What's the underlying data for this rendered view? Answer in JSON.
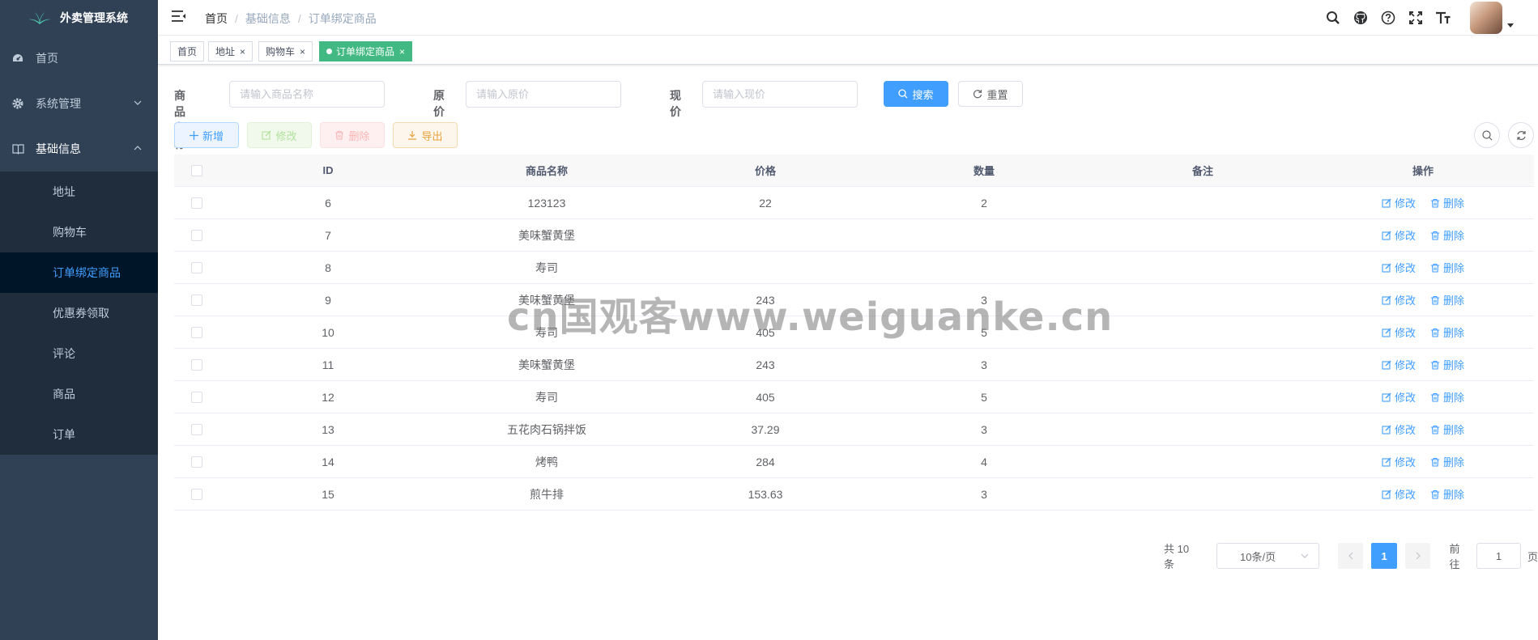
{
  "app": {
    "title": "外卖管理系统"
  },
  "sidebar": {
    "items": [
      {
        "label": "首页",
        "icon": "dashboard-icon"
      },
      {
        "label": "系统管理",
        "icon": "gear-icon"
      },
      {
        "label": "基础信息",
        "icon": "book-icon"
      }
    ],
    "submenu": [
      "地址",
      "购物车",
      "订单绑定商品",
      "优惠券领取",
      "评论",
      "商品",
      "订单"
    ],
    "active": "订单绑定商品"
  },
  "breadcrumb": [
    "首页",
    "基础信息",
    "订单绑定商品"
  ],
  "tags": [
    {
      "label": "首页"
    },
    {
      "label": "地址"
    },
    {
      "label": "购物车"
    },
    {
      "label": "订单绑定商品"
    }
  ],
  "search": {
    "name_label": "商品名称",
    "name_placeholder": "请输入商品名称",
    "orig_label": "原价",
    "orig_placeholder": "请输入原价",
    "now_label": "现价",
    "now_placeholder": "请输入现价",
    "search_btn": "搜索",
    "reset_btn": "重置"
  },
  "toolbar": {
    "add": "新增",
    "edit": "修改",
    "delete": "删除",
    "export": "导出"
  },
  "table": {
    "headers": [
      "ID",
      "商品名称",
      "价格",
      "数量",
      "备注",
      "操作"
    ],
    "rows": [
      [
        "6",
        "123123",
        "22",
        "2",
        ""
      ],
      [
        "7",
        "美味蟹黄堡",
        "",
        "",
        ""
      ],
      [
        "8",
        "寿司",
        "",
        "",
        ""
      ],
      [
        "9",
        "美味蟹黄堡",
        "243",
        "3",
        ""
      ],
      [
        "10",
        "寿司",
        "405",
        "5",
        ""
      ],
      [
        "11",
        "美味蟹黄堡",
        "243",
        "3",
        ""
      ],
      [
        "12",
        "寿司",
        "405",
        "5",
        ""
      ],
      [
        "13",
        "五花肉石锅拌饭",
        "37.29",
        "3",
        ""
      ],
      [
        "14",
        "烤鸭",
        "284",
        "4",
        ""
      ],
      [
        "15",
        "煎牛排",
        "153.63",
        "3",
        ""
      ]
    ],
    "op_edit": "修改",
    "op_delete": "删除"
  },
  "pagination": {
    "total": "共 10 条",
    "size": "10条/页",
    "current": "1",
    "goto_prefix": "前往",
    "goto_value": "1",
    "goto_suffix": "页"
  },
  "watermark": "cn国观客www.weiguanke.cn",
  "colors": {
    "primary": "#409eff",
    "sidebar": "#304156",
    "active_tag": "#42b983"
  }
}
